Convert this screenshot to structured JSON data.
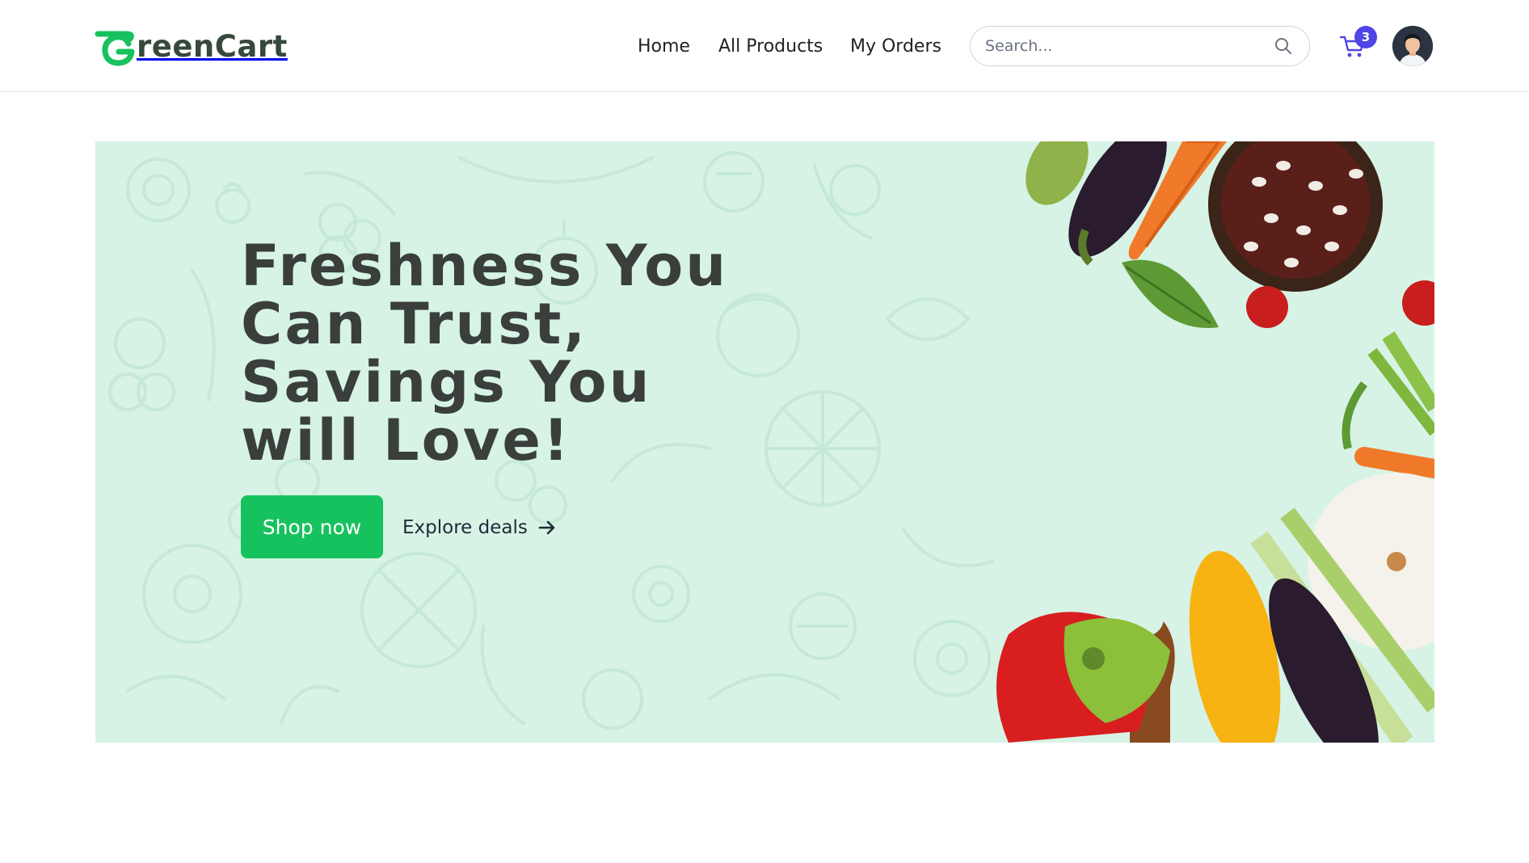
{
  "brand": {
    "name": "reenCart",
    "mark_letter": "G",
    "logo_colors": {
      "mark": "#17c15e",
      "text": "#36493b"
    }
  },
  "nav": {
    "links": [
      {
        "label": "Home"
      },
      {
        "label": "All Products"
      },
      {
        "label": "My Orders"
      }
    ]
  },
  "search": {
    "placeholder": "Search...",
    "icon": "search-icon"
  },
  "cart": {
    "icon": "cart-icon",
    "count": "3",
    "badge_color": "#4f46e5",
    "icon_color": "#4f46e5"
  },
  "user": {
    "icon": "avatar"
  },
  "hero": {
    "title": "Freshness You Can Trust, Savings You will Love!",
    "background_color": "#d6f3e6",
    "primary_cta": {
      "label": "Shop now",
      "color": "#16c25e"
    },
    "secondary_cta": {
      "label": "Explore deals",
      "icon": "arrow-right-icon"
    }
  }
}
